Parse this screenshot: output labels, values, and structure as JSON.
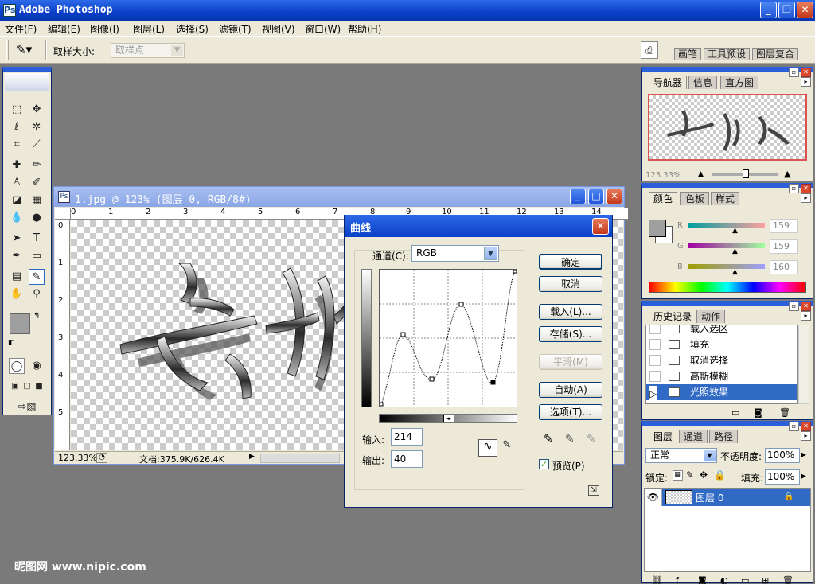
{
  "app": {
    "title": "Adobe Photoshop"
  },
  "menu": [
    "文件(F)",
    "编辑(E)",
    "图像(I)",
    "图层(L)",
    "选择(S)",
    "滤镜(T)",
    "视图(V)",
    "窗口(W)",
    "帮助(H)"
  ],
  "options_bar": {
    "sample_size_label": "取样大小:",
    "sample_size_value": "取样点"
  },
  "palette_well": [
    "画笔",
    "工具预设",
    "图层复合"
  ],
  "document": {
    "title": "1.jpg @ 123% (图层 0, RGB/8#)",
    "zoom": "123.33%",
    "doc_info": "文档:375.9K/626.4K",
    "ruler_h": [
      "0",
      "1",
      "2",
      "3",
      "4",
      "5",
      "6",
      "7",
      "8",
      "9",
      "10",
      "11",
      "12",
      "13",
      "14"
    ],
    "ruler_v": [
      "0",
      "1",
      "2",
      "3",
      "4",
      "5"
    ]
  },
  "curves_dialog": {
    "title": "曲线",
    "channel_label": "通道(C):",
    "channel_value": "RGB",
    "input_label": "输入:",
    "input_value": "214",
    "output_label": "输出:",
    "output_value": "40",
    "buttons": {
      "ok": "确定",
      "cancel": "取消",
      "load": "载入(L)...",
      "save": "存储(S)...",
      "smooth": "平滑(M)",
      "auto": "自动(A)",
      "options": "选项(T)..."
    },
    "preview_label": "预览(P)",
    "preview_checked": true
  },
  "navigator": {
    "tabs": [
      "导航器",
      "信息",
      "直方图"
    ],
    "zoom": "123.33%"
  },
  "color_panel": {
    "tabs": [
      "颜色",
      "色板",
      "样式"
    ],
    "channels": [
      {
        "label": "R",
        "value": "159"
      },
      {
        "label": "G",
        "value": "159"
      },
      {
        "label": "B",
        "value": "160"
      }
    ]
  },
  "history_panel": {
    "tabs": [
      "历史记录",
      "动作"
    ],
    "items": [
      "载入选区",
      "填充",
      "取消选择",
      "高斯模糊",
      "光照效果"
    ],
    "selected_index": 4
  },
  "layers_panel": {
    "tabs": [
      "图层",
      "通道",
      "路径"
    ],
    "blend_mode": "正常",
    "opacity_label": "不透明度:",
    "opacity_value": "100%",
    "lock_label": "锁定:",
    "fill_label": "填充:",
    "fill_value": "100%",
    "layer_name": "图层 0"
  },
  "watermark": "昵图网 www.nipic.com"
}
